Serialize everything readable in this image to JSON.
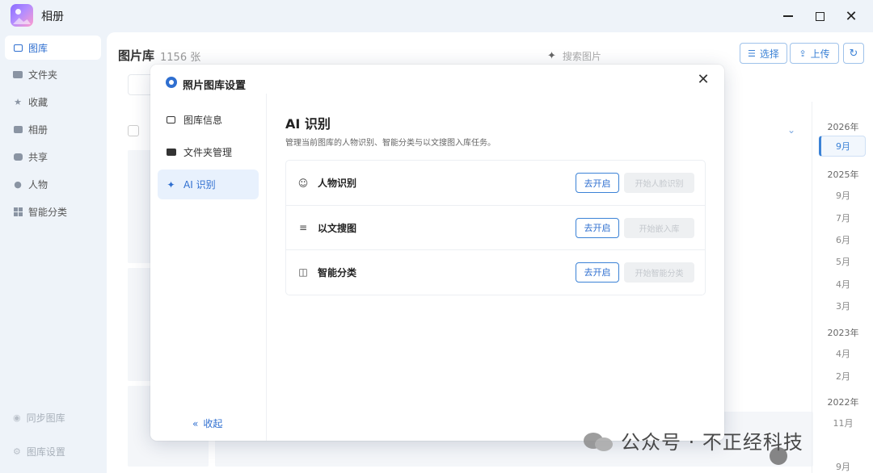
{
  "window": {
    "title": "相册"
  },
  "sidebar": {
    "items": [
      {
        "label": "图库",
        "icon": "image-icon",
        "active": true
      },
      {
        "label": "文件夹",
        "icon": "folder-icon"
      },
      {
        "label": "收藏",
        "icon": "star-icon"
      },
      {
        "label": "相册",
        "icon": "album-icon"
      },
      {
        "label": "共享",
        "icon": "share-icon"
      },
      {
        "label": "人物",
        "icon": "people-icon"
      },
      {
        "label": "智能分类",
        "icon": "grid-icon"
      }
    ],
    "bottom": [
      {
        "label": "同步图库",
        "icon": "sync-icon"
      },
      {
        "label": "图库设置",
        "icon": "settings-icon"
      }
    ]
  },
  "main": {
    "title": "图片库",
    "count": "1156 张",
    "search_placeholder": "搜索图片",
    "select_label": "选择",
    "upload_label": "上传",
    "timeline": [
      {
        "label": "2026年",
        "kind": "year"
      },
      {
        "label": "9月",
        "kind": "month",
        "active": true
      },
      {
        "label": "2025年",
        "kind": "year"
      },
      {
        "label": "9月",
        "kind": "month"
      },
      {
        "label": "7月",
        "kind": "month"
      },
      {
        "label": "6月",
        "kind": "month"
      },
      {
        "label": "5月",
        "kind": "month"
      },
      {
        "label": "4月",
        "kind": "month"
      },
      {
        "label": "3月",
        "kind": "month"
      },
      {
        "label": "2023年",
        "kind": "year"
      },
      {
        "label": "4月",
        "kind": "month"
      },
      {
        "label": "2月",
        "kind": "month"
      },
      {
        "label": "2022年",
        "kind": "year"
      },
      {
        "label": "11月",
        "kind": "month"
      },
      {
        "label": "9月",
        "kind": "month"
      }
    ]
  },
  "modal": {
    "title": "照片图库设置",
    "nav": [
      {
        "label": "图库信息",
        "icon": "image-icon"
      },
      {
        "label": "文件夹管理",
        "icon": "folder-icon"
      },
      {
        "label": "AI 识别",
        "icon": "sparkle-icon",
        "active": true
      }
    ],
    "collapse_label": "收起",
    "panel": {
      "title": "AI 识别",
      "description": "管理当前图库的人物识别、智能分类与以文搜图入库任务。",
      "features": [
        {
          "label": "人物识别",
          "icon": "face-icon",
          "enable_label": "去开启",
          "start_label": "开始人脸识别"
        },
        {
          "label": "以文搜图",
          "icon": "text-search-icon",
          "enable_label": "去开启",
          "start_label": "开始嵌入库"
        },
        {
          "label": "智能分类",
          "icon": "layout-icon",
          "enable_label": "去开启",
          "start_label": "开始智能分类"
        }
      ]
    }
  },
  "watermark": {
    "text": "公众号 · 不正经科技"
  },
  "colors": {
    "accent": "#2f6fd0",
    "accent_light": "#e8f1fd",
    "sidebar_bg": "#eef3f9"
  }
}
